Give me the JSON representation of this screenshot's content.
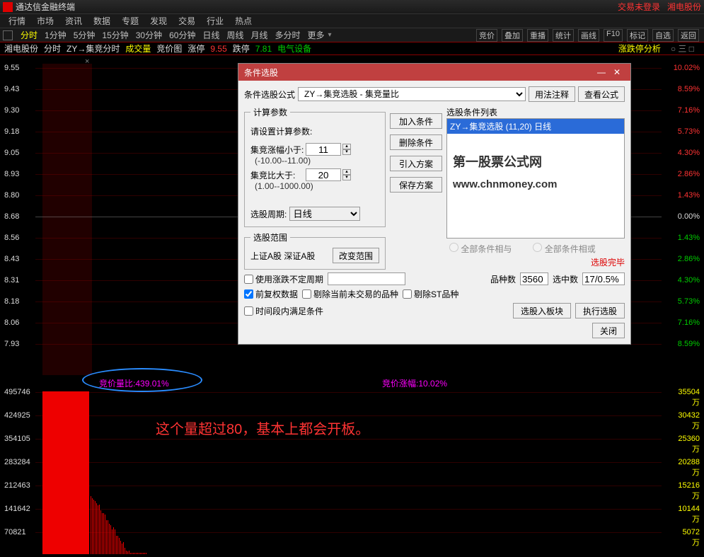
{
  "titlebar": {
    "title": "通达信金融终端",
    "login": "交易未登录",
    "stock": "湘电股份"
  },
  "menubar": [
    "行情",
    "市场",
    "资讯",
    "数据",
    "专题",
    "发现",
    "交易",
    "行业",
    "热点"
  ],
  "timeframes": {
    "active": "分时",
    "items": [
      "分时",
      "1分钟",
      "5分钟",
      "15分钟",
      "30分钟",
      "60分钟",
      "日线",
      "周线",
      "月线",
      "多分时",
      "更多"
    ],
    "right": [
      "竞价",
      "叠加",
      "重播",
      "统计",
      "画线",
      "F10",
      "标记",
      "自选",
      "返回"
    ]
  },
  "infobar": {
    "stock": "湘电股份",
    "mode": "分时",
    "indicator": "ZY→集竞分时",
    "vol": "成交量",
    "bidchart": "竞价图",
    "up": "涨停",
    "upv": "9.55",
    "down": "跌停",
    "downv": "7.81",
    "sector": "电气设备",
    "analysis": "涨跌停分析",
    "icons": "○ 三 □"
  },
  "chart_data": {
    "type": "line",
    "price_axis_left": [
      "9.55",
      "9.43",
      "9.30",
      "9.18",
      "9.05",
      "8.93",
      "8.80",
      "8.68",
      "8.56",
      "8.43",
      "8.31",
      "8.18",
      "8.06",
      "7.93"
    ],
    "price_axis_right": [
      {
        "v": "10.02%",
        "c": "r"
      },
      {
        "v": "8.59%",
        "c": "r"
      },
      {
        "v": "7.16%",
        "c": "r"
      },
      {
        "v": "5.73%",
        "c": "r"
      },
      {
        "v": "4.30%",
        "c": "r"
      },
      {
        "v": "2.86%",
        "c": "r"
      },
      {
        "v": "1.43%",
        "c": "r"
      },
      {
        "v": "0.00%",
        "c": "w"
      },
      {
        "v": "1.43%",
        "c": "g"
      },
      {
        "v": "2.86%",
        "c": "g"
      },
      {
        "v": "4.30%",
        "c": "g"
      },
      {
        "v": "5.73%",
        "c": "g"
      },
      {
        "v": "7.16%",
        "c": "g"
      },
      {
        "v": "8.59%",
        "c": "g"
      }
    ],
    "vol_axis_left": [
      "495746",
      "424925",
      "354105",
      "283284",
      "212463",
      "141642",
      "70821"
    ],
    "vol_axis_right": [
      "35504万",
      "30432万",
      "25360万",
      "20288万",
      "15216万",
      "10144万",
      "5072万"
    ],
    "bid_vol_label": "竞价量比:",
    "bid_vol_value": "439.01%",
    "bid_pct_label": "竞价涨幅:",
    "bid_pct_value": "10.02%",
    "note": "这个量超过80，基本上都会开板。"
  },
  "dialog": {
    "title": "条件选股",
    "formula_label": "条件选股公式",
    "formula_value": "ZY→集竞选股 - 集竞量比",
    "usage_btn": "用法注释",
    "view_btn": "查看公式",
    "params_legend": "计算参数",
    "params_note": "请设置计算参数:",
    "p1_label": "集竞涨幅小于:",
    "p1_value": "11",
    "p1_range": "(-10.00--11.00)",
    "p2_label": "集竞比大于:",
    "p2_value": "20",
    "p2_range": "(1.00--1000.00)",
    "period_label": "选股周期:",
    "period_value": "日线",
    "scope_legend": "选股范围",
    "scope_text": "上证A股 深证A股",
    "scope_btn": "改变范围",
    "mid_btns": [
      "加入条件",
      "删除条件",
      "引入方案",
      "保存方案"
    ],
    "condlist_label": "选股条件列表",
    "cond_item": "ZY→集竞选股 (11,20) 日线",
    "radio1": "全部条件相与",
    "radio2": "全部条件相或",
    "done": "选股完毕",
    "opt_period_label": "使用涨跌不定周期",
    "count_label": "品种数",
    "count_value": "3560",
    "hit_label": "选中数",
    "hit_value": "17/0.5%",
    "cb1": "前复权数据",
    "cb2": "剔除当前未交易的品种",
    "cb3": "剔除ST品种",
    "cb4": "时间段内满足条件",
    "btn_block": "选股入板块",
    "btn_run": "执行选股",
    "btn_close": "关闭"
  },
  "watermark": {
    "l1": "第一股票公式网",
    "l2": "www.chnmoney.com"
  }
}
